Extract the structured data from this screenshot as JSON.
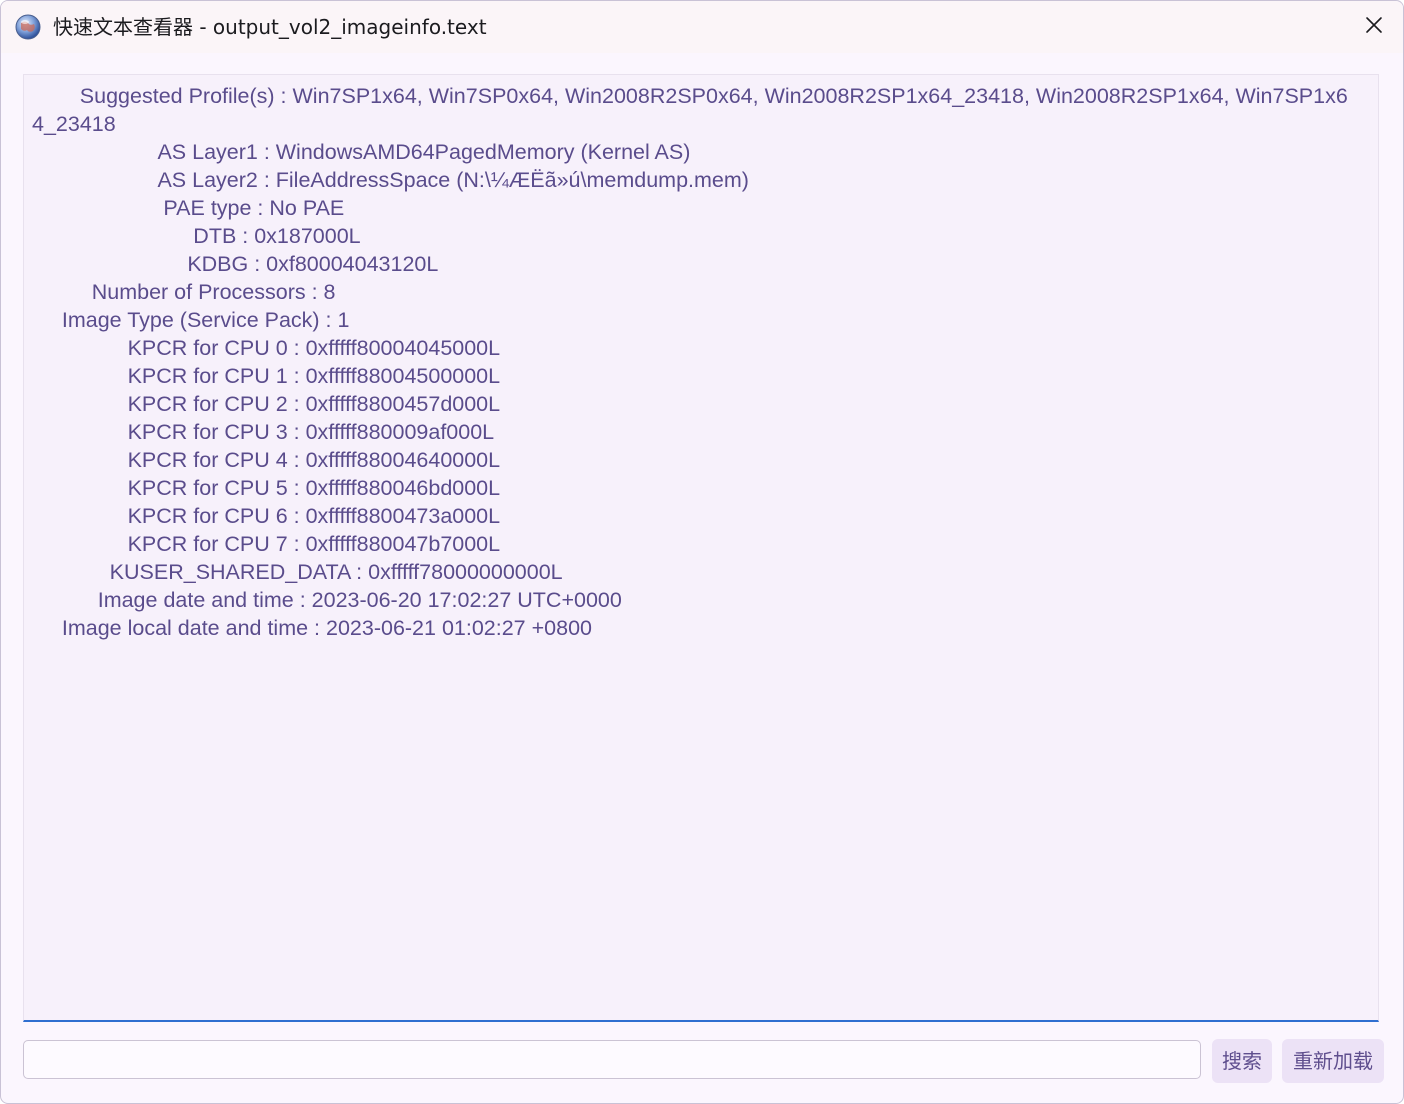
{
  "window": {
    "title": "快速文本查看器 - output_vol2_imageinfo.text"
  },
  "icons": {
    "app": "globe-app-icon",
    "close": "close-icon"
  },
  "content": {
    "text": "        Suggested Profile(s) : Win7SP1x64, Win7SP0x64, Win2008R2SP0x64, Win2008R2SP1x64_23418, Win2008R2SP1x64, Win7SP1x64_23418\n                     AS Layer1 : WindowsAMD64PagedMemory (Kernel AS)\n                     AS Layer2 : FileAddressSpace (N:\\¼ÆËã»ú\\memdump.mem)\n                      PAE type : No PAE\n                           DTB : 0x187000L\n                          KDBG : 0xf80004043120L\n          Number of Processors : 8\n     Image Type (Service Pack) : 1\n                KPCR for CPU 0 : 0xfffff80004045000L\n                KPCR for CPU 1 : 0xfffff88004500000L\n                KPCR for CPU 2 : 0xfffff8800457d000L\n                KPCR for CPU 3 : 0xfffff880009af000L\n                KPCR for CPU 4 : 0xfffff88004640000L\n                KPCR for CPU 5 : 0xfffff880046bd000L\n                KPCR for CPU 6 : 0xfffff8800473a000L\n                KPCR for CPU 7 : 0xfffff880047b7000L\n             KUSER_SHARED_DATA : 0xfffff78000000000L\n           Image date and time : 2023-06-20 17:02:27 UTC+0000\n     Image local date and time : 2023-06-21 01:02:27 +0800"
  },
  "search": {
    "value": "",
    "placeholder": ""
  },
  "buttons": {
    "search_label": "搜索",
    "reload_label": "重新加载"
  },
  "colors": {
    "text": "#5a4c8c",
    "accent": "#2f6fd0",
    "button_bg": "#ece2f6"
  }
}
